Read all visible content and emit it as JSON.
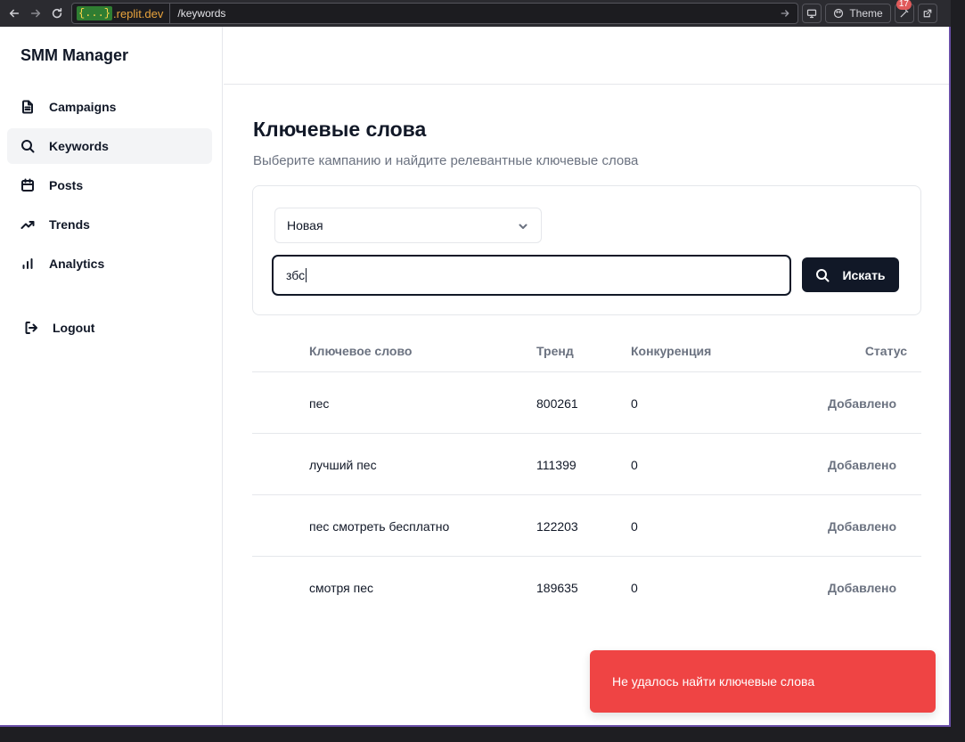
{
  "browser": {
    "domain_braces": "{...}",
    "domain_host": ".replit.dev",
    "path": "/keywords",
    "theme_label": "Theme",
    "notification_count": "17"
  },
  "sidebar": {
    "brand": "SMM Manager",
    "items": [
      {
        "label": "Campaigns",
        "icon": "file-text-icon"
      },
      {
        "label": "Keywords",
        "icon": "search-icon",
        "active": true
      },
      {
        "label": "Posts",
        "icon": "calendar-icon"
      },
      {
        "label": "Trends",
        "icon": "trending-up-icon"
      },
      {
        "label": "Analytics",
        "icon": "bar-chart-icon"
      }
    ],
    "logout_label": "Logout"
  },
  "main": {
    "title": "Ключевые слова",
    "subtitle": "Выберите кампанию и найдите релевантные ключевые слова",
    "campaign_select": {
      "value": "Новая"
    },
    "search": {
      "value": "збс",
      "button_label": "Искать"
    },
    "table": {
      "headers": [
        "Ключевое слово",
        "Тренд",
        "Конкуренция",
        "Статус"
      ],
      "rows": [
        {
          "keyword": "пес",
          "trend": "800261",
          "competition": "0",
          "status": "Добавлено"
        },
        {
          "keyword": "лучший пес",
          "trend": "111399",
          "competition": "0",
          "status": "Добавлено"
        },
        {
          "keyword": "пес смотреть бесплатно",
          "trend": "122203",
          "competition": "0",
          "status": "Добавлено"
        },
        {
          "keyword": "смотря пес",
          "trend": "189635",
          "competition": "0",
          "status": "Добавлено"
        }
      ]
    }
  },
  "toast": {
    "message": "Не удалось найти ключевые слова"
  }
}
